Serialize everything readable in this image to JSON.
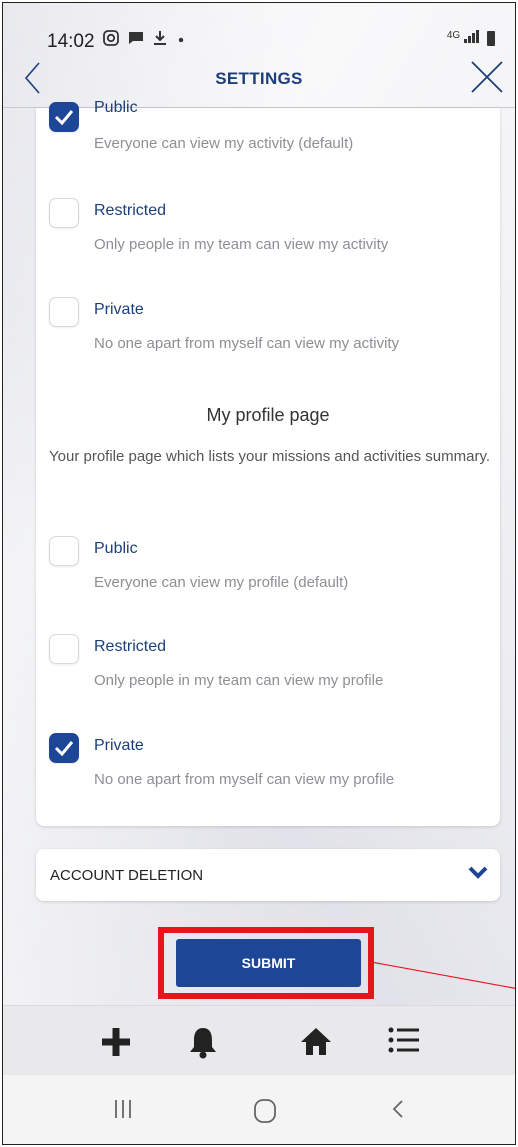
{
  "status_bar": {
    "time": "14:02",
    "left_icons": [
      "instagram-icon",
      "chat-icon",
      "download-icon",
      "dot-icon"
    ],
    "network": "4G"
  },
  "header": {
    "title": "SETTINGS",
    "back_icon": "chevron-left-icon",
    "close_icon": "close-icon"
  },
  "activity_options": [
    {
      "label": "Public",
      "description": "Everyone can view my activity (default)",
      "checked": true
    },
    {
      "label": "Restricted",
      "description": "Only people in my team can view my activity",
      "checked": false
    },
    {
      "label": "Private",
      "description": "No one apart from myself can view my activity",
      "checked": false
    }
  ],
  "profile_section": {
    "title": "My profile page",
    "description": "Your profile page which lists your missions and activities summary."
  },
  "profile_options": [
    {
      "label": "Public",
      "description": "Everyone can view my profile (default)",
      "checked": false
    },
    {
      "label": "Restricted",
      "description": "Only people in my team can view my profile",
      "checked": false
    },
    {
      "label": "Private",
      "description": "No one apart from myself can view my profile",
      "checked": true
    }
  ],
  "account_deletion": {
    "label": "ACCOUNT DELETION",
    "icon": "chevron-down-icon"
  },
  "submit": {
    "label": "SUBMIT"
  },
  "bottom_nav": [
    "plus-icon",
    "bell-icon",
    "home-icon",
    "menu-list-icon"
  ],
  "android_nav": [
    "recents-icon",
    "home-circle-icon",
    "back-icon"
  ],
  "colors": {
    "primary": "#1d4796",
    "title": "#1c3f7a",
    "highlight": "#e8141b"
  }
}
